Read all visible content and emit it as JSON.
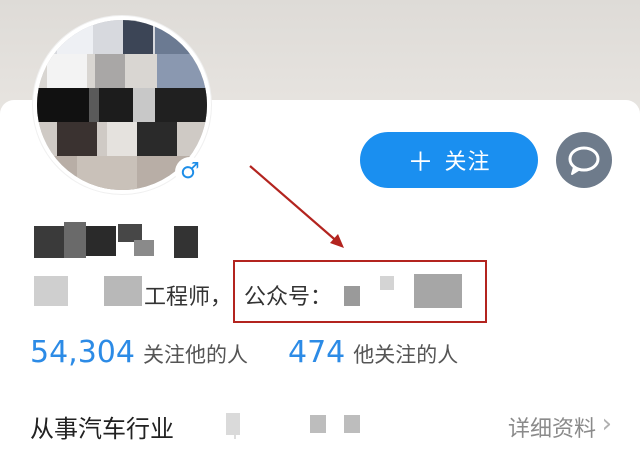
{
  "profile": {
    "gender_symbol": "♂",
    "follow_button_label": "关注",
    "follow_plus": "＋",
    "title_suffix": "工程师，",
    "official_account_label": "公众号：",
    "stats": [
      {
        "value": "54,304",
        "label": "关注他的人"
      },
      {
        "value": "474",
        "label": "他关注的人"
      }
    ],
    "industry_label": "从事汽车行业",
    "detail_link_label": "详细资料",
    "chevron": "›"
  },
  "colors": {
    "accent": "#1a8ff0",
    "stat_number": "#2c8be6",
    "annotation_red": "#b3241f",
    "message_button": "#6e7b8b"
  },
  "icons": {
    "gender": "male-gender-icon",
    "message": "speech-bubble-icon",
    "chevron": "chevron-right-icon"
  }
}
